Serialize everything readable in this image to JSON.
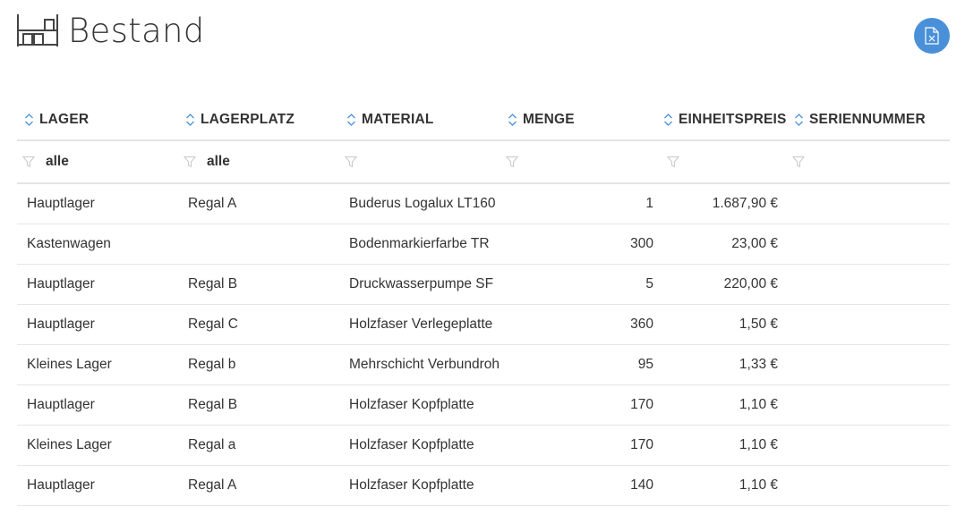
{
  "header": {
    "title": "Bestand",
    "icon": "warehouse-shelf-icon"
  },
  "toolbar": {
    "export_icon": "excel-export-icon",
    "accent_color": "#4a90d9"
  },
  "table": {
    "columns": [
      {
        "label": "LAGER"
      },
      {
        "label": "LAGERPLATZ"
      },
      {
        "label": "MATERIAL"
      },
      {
        "label": "MENGE"
      },
      {
        "label": "EINHEITSPREIS"
      },
      {
        "label": "SERIENNUMMER"
      }
    ],
    "filters": [
      "alle",
      "alle",
      "",
      "",
      "",
      ""
    ],
    "rows": [
      {
        "lager": "Hauptlager",
        "lagerplatz": "Regal A",
        "material": "Buderus Logalux LT160",
        "menge": "1",
        "preis": "1.687,90 €",
        "serie": ""
      },
      {
        "lager": "Kastenwagen",
        "lagerplatz": "",
        "material": "Bodenmarkierfarbe TR",
        "menge": "300",
        "preis": "23,00 €",
        "serie": ""
      },
      {
        "lager": "Hauptlager",
        "lagerplatz": "Regal B",
        "material": "Druckwasserpumpe SF",
        "menge": "5",
        "preis": "220,00 €",
        "serie": ""
      },
      {
        "lager": "Hauptlager",
        "lagerplatz": "Regal C",
        "material": "Holzfaser Verlegeplatte",
        "menge": "360",
        "preis": "1,50 €",
        "serie": ""
      },
      {
        "lager": "Kleines Lager",
        "lagerplatz": "Regal b",
        "material": "Mehrschicht Verbundrohr",
        "menge": "95",
        "preis": "1,33 €",
        "serie": ""
      },
      {
        "lager": "Hauptlager",
        "lagerplatz": "Regal B",
        "material": "Holzfaser Kopfplatte",
        "menge": "170",
        "preis": "1,10 €",
        "serie": ""
      },
      {
        "lager": "Kleines Lager",
        "lagerplatz": "Regal a",
        "material": "Holzfaser Kopfplatte",
        "menge": "170",
        "preis": "1,10 €",
        "serie": ""
      },
      {
        "lager": "Hauptlager",
        "lagerplatz": "Regal A",
        "material": "Holzfaser Kopfplatte",
        "menge": "140",
        "preis": "1,10 €",
        "serie": ""
      }
    ]
  }
}
